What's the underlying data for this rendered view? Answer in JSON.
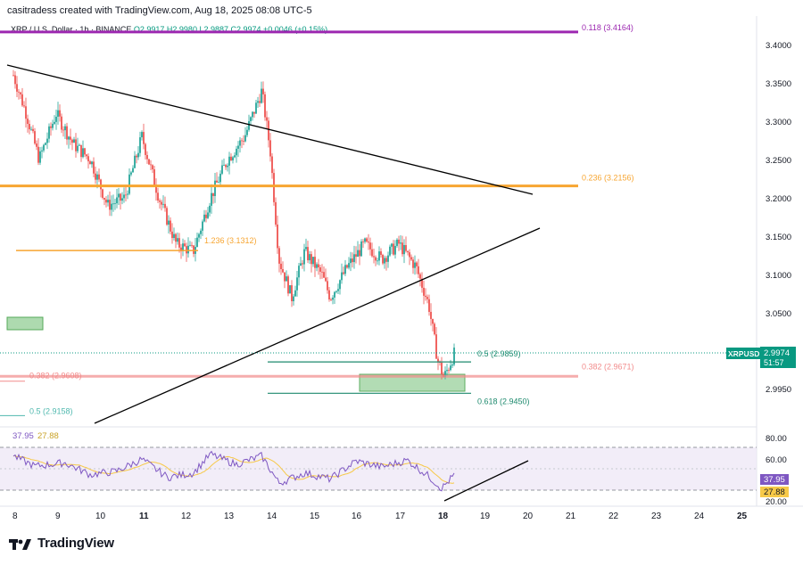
{
  "header": {
    "credit": "casitradess created with TradingView.com, Aug 18, 2025 08:08 UTC-5",
    "symbol": "XRP / U.S. Dollar · 1h · BINANCE",
    "ohlc": "O2.9917 H2.9980 L2.9887 C2.9974 +0.0046 (+0.15%)"
  },
  "price_axis": {
    "ticks": [
      "3.4000",
      "3.3500",
      "3.3000",
      "3.2500",
      "3.2000",
      "3.1500",
      "3.1000",
      "3.0500",
      "2.9950"
    ],
    "last_price_symbol": "XRPUSD",
    "last_price": "2.9974",
    "countdown": "51:57"
  },
  "fib_levels": [
    {
      "label": "0.118 (3.4164)",
      "price": 3.4164,
      "color": "#9c27b0"
    },
    {
      "label": "0.236 (3.2156)",
      "price": 3.2156,
      "color": "#f7a531"
    },
    {
      "label": "1.236 (3.1312)",
      "price": 3.1312,
      "color": "#f7a531"
    },
    {
      "label": "0.5 (2.9859)",
      "price": 2.9859,
      "color": "#1e8a6e"
    },
    {
      "label": "0.382 (2.9671)",
      "price": 2.9671,
      "color": "#f28b8b"
    },
    {
      "label": "0.382 (2.9608)",
      "price": 2.9608,
      "color": "#f28b8b"
    },
    {
      "label": "0.618 (2.9450)",
      "price": 2.945,
      "color": "#1e8a6e"
    },
    {
      "label": "0.5 (2.9158)",
      "price": 2.9158,
      "color": "#4fb8ae"
    }
  ],
  "rsi": {
    "value_label": "37.95",
    "ma_label": "27.88",
    "ticks": [
      "80.00",
      "60.00",
      "20.00"
    ],
    "badge_rsi": "37.95",
    "badge_ma": "27.88",
    "rsi_color": "#7e57c2",
    "ma_color": "#f7c948"
  },
  "x_axis": {
    "labels": [
      "8",
      "9",
      "10",
      "11",
      "12",
      "13",
      "14",
      "15",
      "16",
      "17",
      "18",
      "19",
      "20",
      "21",
      "22",
      "23",
      "24",
      "25"
    ]
  },
  "footer": {
    "brand": "TradingView"
  },
  "colors": {
    "up": "#26a69a",
    "down": "#ef5350",
    "trendline": "#000000"
  },
  "chart_data": {
    "type": "candlestick",
    "symbol": "XRPUSD",
    "timeframe": "1h",
    "ylim": [
      2.91,
      3.42
    ],
    "x_range": [
      "Aug 8",
      "Aug 25"
    ],
    "close_path": [
      {
        "day": 8.0,
        "close": 3.36
      },
      {
        "day": 8.3,
        "close": 3.31
      },
      {
        "day": 8.6,
        "close": 3.25
      },
      {
        "day": 9.0,
        "close": 3.31
      },
      {
        "day": 9.4,
        "close": 3.27
      },
      {
        "day": 9.8,
        "close": 3.25
      },
      {
        "day": 10.2,
        "close": 3.19
      },
      {
        "day": 10.6,
        "close": 3.2
      },
      {
        "day": 11.0,
        "close": 3.28
      },
      {
        "day": 11.4,
        "close": 3.2
      },
      {
        "day": 11.8,
        "close": 3.14
      },
      {
        "day": 12.2,
        "close": 3.13
      },
      {
        "day": 12.6,
        "close": 3.2
      },
      {
        "day": 13.0,
        "close": 3.25
      },
      {
        "day": 13.4,
        "close": 3.28
      },
      {
        "day": 13.8,
        "close": 3.34
      },
      {
        "day": 14.0,
        "close": 3.26
      },
      {
        "day": 14.2,
        "close": 3.12
      },
      {
        "day": 14.5,
        "close": 3.07
      },
      {
        "day": 14.8,
        "close": 3.13
      },
      {
        "day": 15.2,
        "close": 3.1
      },
      {
        "day": 15.4,
        "close": 3.07
      },
      {
        "day": 15.8,
        "close": 3.11
      },
      {
        "day": 16.2,
        "close": 3.14
      },
      {
        "day": 16.6,
        "close": 3.12
      },
      {
        "day": 17.0,
        "close": 3.14
      },
      {
        "day": 17.4,
        "close": 3.11
      },
      {
        "day": 17.7,
        "close": 3.06
      },
      {
        "day": 17.9,
        "close": 2.99
      },
      {
        "day": 18.05,
        "close": 2.965
      },
      {
        "day": 18.3,
        "close": 2.9974
      }
    ],
    "rsi_path": [
      {
        "day": 8.0,
        "rsi": 60
      },
      {
        "day": 8.5,
        "rsi": 48
      },
      {
        "day": 9.2,
        "rsi": 52
      },
      {
        "day": 9.8,
        "rsi": 38
      },
      {
        "day": 10.4,
        "rsi": 42
      },
      {
        "day": 11.0,
        "rsi": 56
      },
      {
        "day": 11.6,
        "rsi": 35
      },
      {
        "day": 12.2,
        "rsi": 40
      },
      {
        "day": 12.6,
        "rsi": 62
      },
      {
        "day": 13.2,
        "rsi": 50
      },
      {
        "day": 13.8,
        "rsi": 60
      },
      {
        "day": 14.2,
        "rsi": 28
      },
      {
        "day": 14.8,
        "rsi": 40
      },
      {
        "day": 15.4,
        "rsi": 33
      },
      {
        "day": 16.0,
        "rsi": 54
      },
      {
        "day": 16.6,
        "rsi": 47
      },
      {
        "day": 17.2,
        "rsi": 55
      },
      {
        "day": 17.7,
        "rsi": 36
      },
      {
        "day": 18.0,
        "rsi": 22
      },
      {
        "day": 18.3,
        "rsi": 37.95
      }
    ]
  }
}
